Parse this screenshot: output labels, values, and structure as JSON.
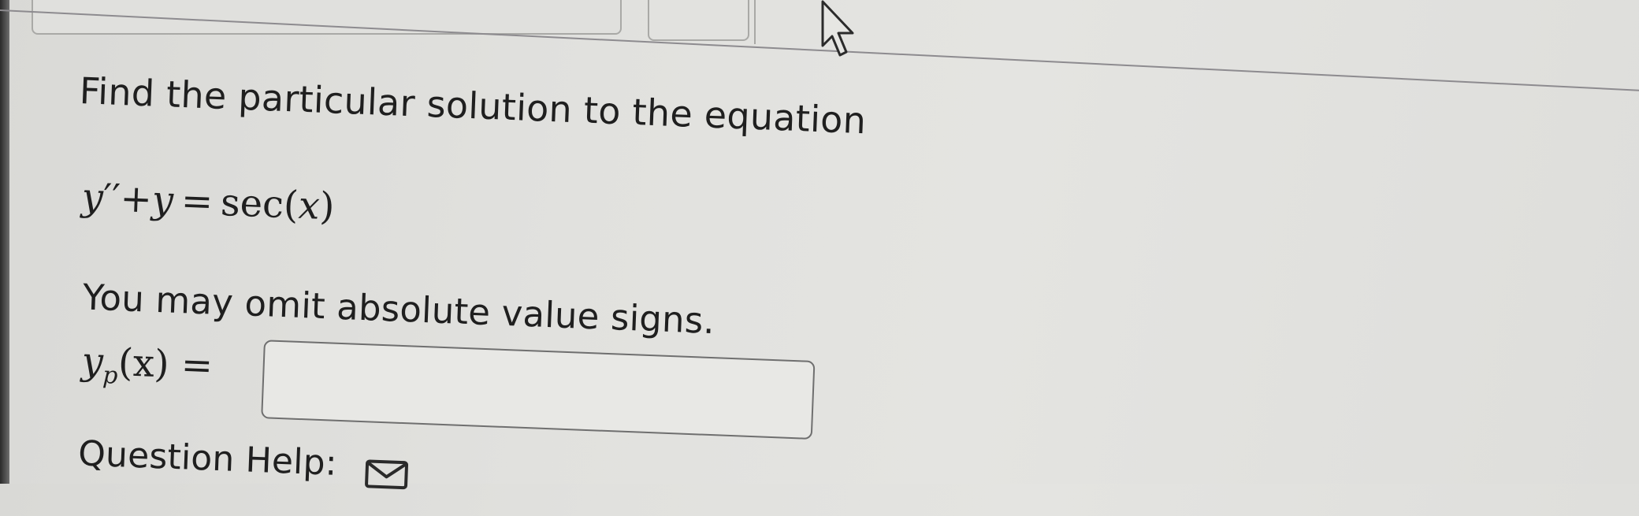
{
  "question": {
    "prompt": "Find the particular solution to the equation",
    "equation": {
      "lhs_var1": "y",
      "lhs_prime": "′′",
      "plus": "+",
      "lhs_var2": "y",
      "equals": "=",
      "rhs_func": "sec",
      "rhs_open": "(",
      "rhs_var": "x",
      "rhs_close": ")"
    },
    "note": "You may omit absolute value signs."
  },
  "answer": {
    "label_var": "y",
    "label_sub": "p",
    "label_arg": "(x)",
    "label_eq": "=",
    "value": ""
  },
  "help": {
    "label": "Question Help:",
    "icon": "message-icon"
  },
  "cursor": {
    "icon": "mouse-pointer-icon"
  }
}
